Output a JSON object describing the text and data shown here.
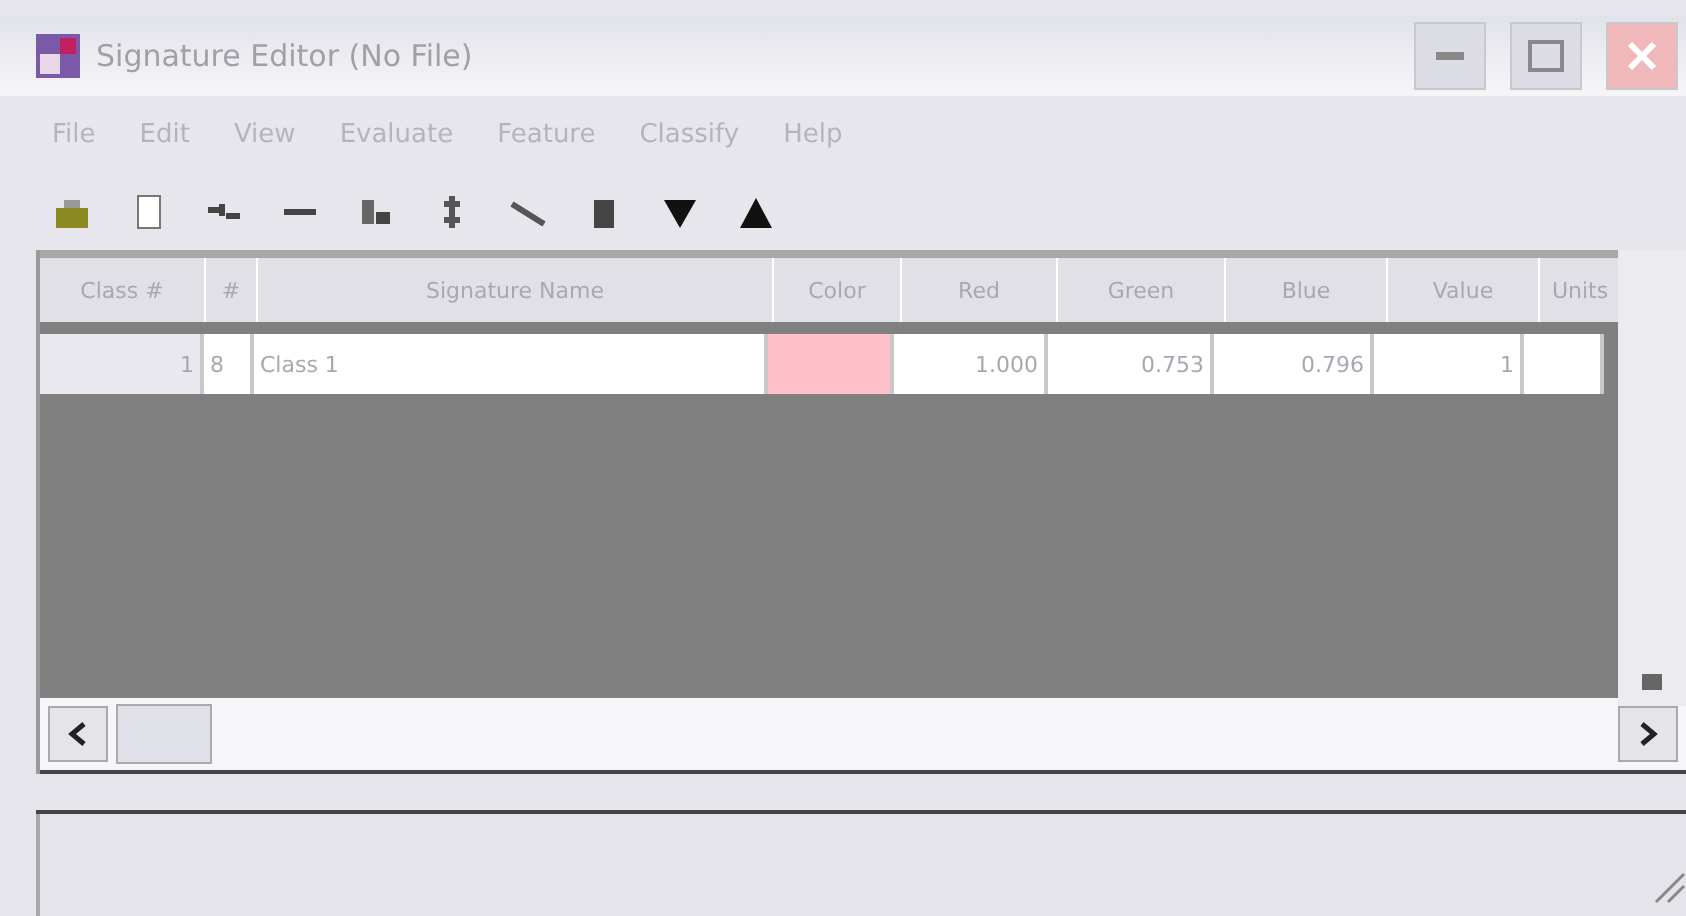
{
  "window": {
    "title": "Signature Editor (No File)"
  },
  "menu": [
    "File",
    "Edit",
    "View",
    "Evaluate",
    "Feature",
    "Classify",
    "Help"
  ],
  "table": {
    "columns": [
      "Class #",
      "#",
      "Signature Name",
      "Color",
      "Red",
      "Green",
      "Blue",
      "Value",
      "Units"
    ],
    "rows": [
      {
        "class": "1",
        "mark": "8",
        "name": "Class 1",
        "color": "#ffc0cb",
        "red": "1.000",
        "green": "0.753",
        "blue": "0.796",
        "value": "1",
        "units": ""
      }
    ]
  }
}
